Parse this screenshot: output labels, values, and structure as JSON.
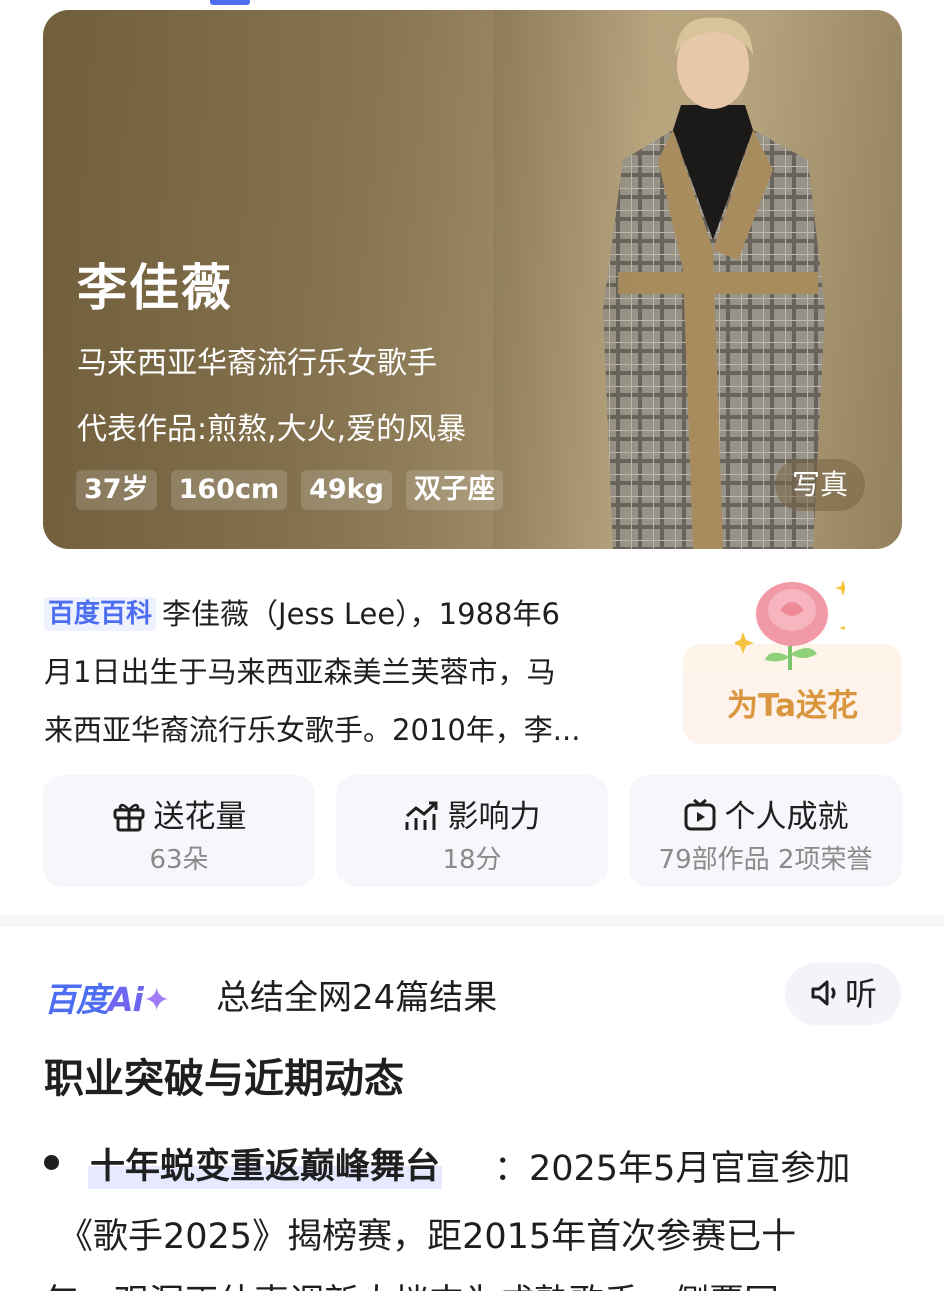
{
  "hero": {
    "name": "李佳薇",
    "subtitle": "马来西亚华裔流行乐女歌手",
    "works": "代表作品:煎熬,大火,爱的风暴",
    "tags": [
      "37岁",
      "160cm",
      "49kg",
      "双子座"
    ],
    "photo_button": "写真"
  },
  "baike": {
    "source_tag": "百度百科",
    "lines": [
      "李佳薇（Jess Lee），1988年6",
      "月1日出生于马来西亚森美兰芙蓉市，马",
      "来西亚华裔流行乐女歌手。2010年，李..."
    ]
  },
  "flower_card": {
    "label": "为Ta送花"
  },
  "stats": [
    {
      "title": "送花量",
      "value": "63朵",
      "icon": "gift-icon"
    },
    {
      "title": "影响力",
      "value": "18分",
      "icon": "trend-chart-icon"
    },
    {
      "title": "个人成就",
      "value": "79部作品 2项荣誉",
      "icon": "video-play-icon"
    }
  ],
  "ai": {
    "logo_text": "百度",
    "logo_ai": "Ai",
    "summary": "总结全网24篇结果",
    "listen_label": "听"
  },
  "section": {
    "title": "职业突破与近期动态",
    "bullet_head": "十年蜕变重返巅峰舞台",
    "bullet_rest": "：2025年5月官宣参加",
    "bullet_line2": "《歌手2025》揭榜赛，距2015年首次参赛已十",
    "bullet_line3": "年，观洞正估声调新大挡支为成熟歌手，侧覆同"
  },
  "colors": {
    "brand_blue": "#4e6ef2",
    "flower_orange": "#d9963e",
    "card_bg": "#f5f7fb"
  }
}
